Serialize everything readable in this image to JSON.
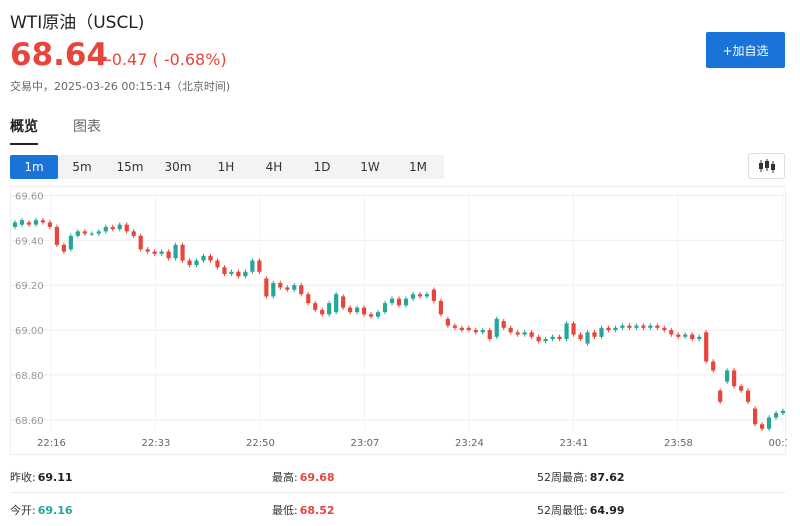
{
  "header": {
    "title": "WTI原油（USCL)",
    "price": "68.64",
    "change": "-0.47 ( -0.68%)",
    "status": "交易中，2025-03-26 00:15:14（北京时间)",
    "add_button": "+加自选"
  },
  "tabs": [
    {
      "label": "概览",
      "active": true
    },
    {
      "label": "图表",
      "active": false
    }
  ],
  "intervals": [
    {
      "label": "1m",
      "active": true
    },
    {
      "label": "5m",
      "active": false
    },
    {
      "label": "15m",
      "active": false
    },
    {
      "label": "30m",
      "active": false
    },
    {
      "label": "1H",
      "active": false
    },
    {
      "label": "4H",
      "active": false
    },
    {
      "label": "1D",
      "active": false
    },
    {
      "label": "1W",
      "active": false
    },
    {
      "label": "1M",
      "active": false
    }
  ],
  "colors": {
    "up": "#26a69a",
    "down": "#e8453c",
    "accent": "#1a73d9"
  },
  "icons": {
    "candle_toggle": "candlestick-icon"
  },
  "chart_data": {
    "type": "candlestick",
    "ylim": [
      68.55,
      69.62
    ],
    "y_ticks": [
      "69.60",
      "69.40",
      "69.20",
      "69.00",
      "68.80",
      "68.60"
    ],
    "y_tick_values": [
      69.6,
      69.4,
      69.2,
      69.0,
      68.8,
      68.6
    ],
    "x_ticks": [
      "22:16",
      "22:33",
      "22:50",
      "23:07",
      "23:24",
      "23:41",
      "23:58",
      "00:1"
    ],
    "grid": true,
    "candles": [
      {
        "o": 69.46,
        "c": 69.48
      },
      {
        "o": 69.47,
        "c": 69.49
      },
      {
        "o": 69.48,
        "c": 69.47
      },
      {
        "o": 69.47,
        "c": 69.49
      },
      {
        "o": 69.49,
        "c": 69.48
      },
      {
        "o": 69.48,
        "c": 69.46
      },
      {
        "o": 69.46,
        "c": 69.38
      },
      {
        "o": 69.38,
        "c": 69.35
      },
      {
        "o": 69.36,
        "c": 69.42
      },
      {
        "o": 69.42,
        "c": 69.44
      },
      {
        "o": 69.44,
        "c": 69.43
      },
      {
        "o": 69.43,
        "c": 69.43
      },
      {
        "o": 69.43,
        "c": 69.44
      },
      {
        "o": 69.44,
        "c": 69.46
      },
      {
        "o": 69.46,
        "c": 69.45
      },
      {
        "o": 69.45,
        "c": 69.47
      },
      {
        "o": 69.47,
        "c": 69.44
      },
      {
        "o": 69.44,
        "c": 69.42
      },
      {
        "o": 69.42,
        "c": 69.36
      },
      {
        "o": 69.36,
        "c": 69.35
      },
      {
        "o": 69.35,
        "c": 69.34
      },
      {
        "o": 69.34,
        "c": 69.35
      },
      {
        "o": 69.35,
        "c": 69.32
      },
      {
        "o": 69.32,
        "c": 69.38
      },
      {
        "o": 69.38,
        "c": 69.31
      },
      {
        "o": 69.31,
        "c": 69.29
      },
      {
        "o": 69.29,
        "c": 69.31
      },
      {
        "o": 69.31,
        "c": 69.33
      },
      {
        "o": 69.33,
        "c": 69.31
      },
      {
        "o": 69.31,
        "c": 69.28
      },
      {
        "o": 69.28,
        "c": 69.25
      },
      {
        "o": 69.25,
        "c": 69.26
      },
      {
        "o": 69.26,
        "c": 69.24
      },
      {
        "o": 69.24,
        "c": 69.26
      },
      {
        "o": 69.26,
        "c": 69.31
      },
      {
        "o": 69.31,
        "c": 69.26
      },
      {
        "o": 69.23,
        "c": 69.15
      },
      {
        "o": 69.15,
        "c": 69.21
      },
      {
        "o": 69.21,
        "c": 69.19
      },
      {
        "o": 69.19,
        "c": 69.18
      },
      {
        "o": 69.18,
        "c": 69.2
      },
      {
        "o": 69.2,
        "c": 69.16
      },
      {
        "o": 69.16,
        "c": 69.12
      },
      {
        "o": 69.12,
        "c": 69.09
      },
      {
        "o": 69.09,
        "c": 69.07
      },
      {
        "o": 69.07,
        "c": 69.12
      },
      {
        "o": 69.08,
        "c": 69.16
      },
      {
        "o": 69.15,
        "c": 69.1
      },
      {
        "o": 69.1,
        "c": 69.08
      },
      {
        "o": 69.08,
        "c": 69.1
      },
      {
        "o": 69.1,
        "c": 69.07
      },
      {
        "o": 69.07,
        "c": 69.06
      },
      {
        "o": 69.06,
        "c": 69.08
      },
      {
        "o": 69.08,
        "c": 69.12
      },
      {
        "o": 69.12,
        "c": 69.14
      },
      {
        "o": 69.14,
        "c": 69.11
      },
      {
        "o": 69.11,
        "c": 69.14
      },
      {
        "o": 69.14,
        "c": 69.16
      },
      {
        "o": 69.16,
        "c": 69.15
      },
      {
        "o": 69.15,
        "c": 69.16
      },
      {
        "o": 69.18,
        "c": 69.13
      },
      {
        "o": 69.13,
        "c": 69.07
      },
      {
        "o": 69.05,
        "c": 69.02
      },
      {
        "o": 69.02,
        "c": 69.01
      },
      {
        "o": 69.01,
        "c": 69.0
      },
      {
        "o": 69.01,
        "c": 69.0
      },
      {
        "o": 69.0,
        "c": 68.99
      },
      {
        "o": 68.99,
        "c": 69.0
      },
      {
        "o": 69.0,
        "c": 68.96
      },
      {
        "o": 68.97,
        "c": 69.05
      },
      {
        "o": 69.04,
        "c": 69.01
      },
      {
        "o": 69.01,
        "c": 68.99
      },
      {
        "o": 68.99,
        "c": 68.98
      },
      {
        "o": 68.98,
        "c": 68.99
      },
      {
        "o": 68.99,
        "c": 68.97
      },
      {
        "o": 68.97,
        "c": 68.95
      },
      {
        "o": 68.95,
        "c": 68.96
      },
      {
        "o": 68.96,
        "c": 68.97
      },
      {
        "o": 68.97,
        "c": 68.96
      },
      {
        "o": 68.96,
        "c": 69.03
      },
      {
        "o": 69.03,
        "c": 68.98
      },
      {
        "o": 68.98,
        "c": 68.96
      },
      {
        "o": 68.94,
        "c": 68.99
      },
      {
        "o": 68.99,
        "c": 68.97
      },
      {
        "o": 68.97,
        "c": 69.01
      },
      {
        "o": 69.01,
        "c": 69.0
      },
      {
        "o": 69.0,
        "c": 69.01
      },
      {
        "o": 69.01,
        "c": 69.02
      },
      {
        "o": 69.02,
        "c": 69.01
      },
      {
        "o": 69.01,
        "c": 69.02
      },
      {
        "o": 69.02,
        "c": 69.01
      },
      {
        "o": 69.01,
        "c": 69.02
      },
      {
        "o": 69.02,
        "c": 69.01
      },
      {
        "o": 69.01,
        "c": 69.0
      },
      {
        "o": 69.0,
        "c": 68.98
      },
      {
        "o": 68.98,
        "c": 68.97
      },
      {
        "o": 68.97,
        "c": 68.98
      },
      {
        "o": 68.98,
        "c": 68.96
      },
      {
        "o": 68.96,
        "c": 68.97
      },
      {
        "o": 68.99,
        "c": 68.86
      },
      {
        "o": 68.86,
        "c": 68.82
      },
      {
        "o": 68.73,
        "c": 68.68
      },
      {
        "o": 68.77,
        "c": 68.82
      },
      {
        "o": 68.82,
        "c": 68.75
      },
      {
        "o": 68.75,
        "c": 68.73
      },
      {
        "o": 68.73,
        "c": 68.68
      },
      {
        "o": 68.65,
        "c": 68.58
      },
      {
        "o": 68.58,
        "c": 68.56
      },
      {
        "o": 68.56,
        "c": 68.61
      },
      {
        "o": 68.61,
        "c": 68.63
      },
      {
        "o": 68.63,
        "c": 68.64
      }
    ]
  },
  "stats": {
    "prev_close_label": "昨收:",
    "prev_close": "69.11",
    "high_label": "最高:",
    "high": "69.68",
    "high52_label": "52周最高:",
    "high52": "87.62",
    "open_label": "今开:",
    "open": "69.16",
    "low_label": "最低:",
    "low": "68.52",
    "low52_label": "52周最低:",
    "low52": "64.99"
  }
}
